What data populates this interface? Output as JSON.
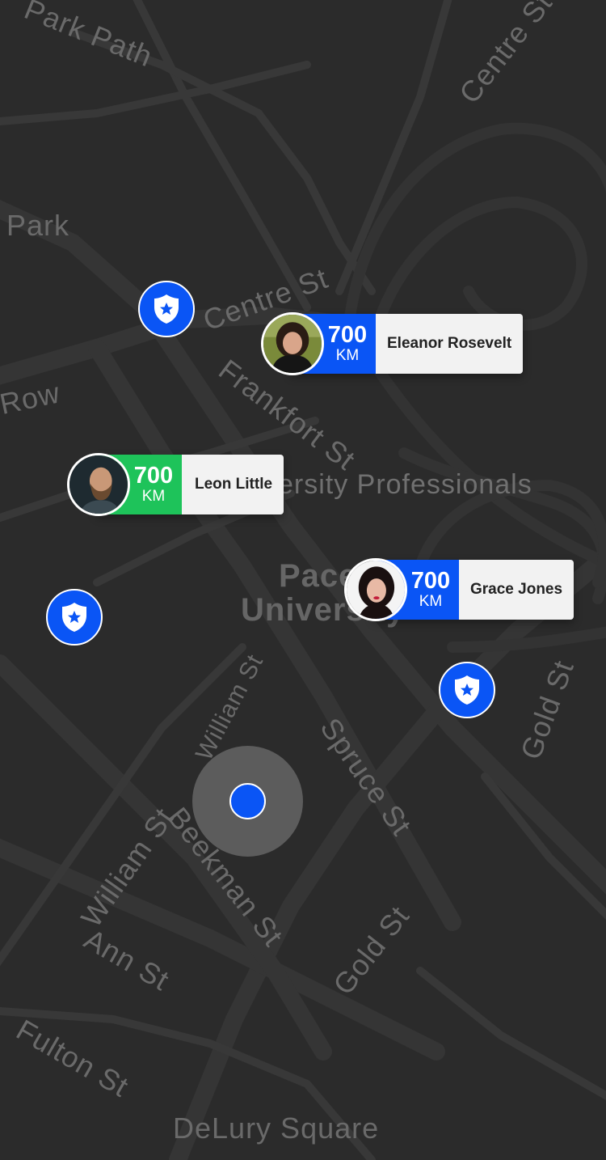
{
  "map": {
    "street_labels": [
      "Park Path",
      "Centre St",
      "Park",
      "Centre St",
      "Row",
      "Frankfort St",
      "Pace University Professionals",
      "Pace",
      "University",
      "William St",
      "Spruce St",
      "Gold St",
      "William St",
      "Beekman St",
      "Ann St",
      "Gold St",
      "Fulton St",
      "DeLury Square"
    ]
  },
  "police_markers": [
    {
      "icon": "police-badge-icon"
    },
    {
      "icon": "police-badge-icon"
    },
    {
      "icon": "police-badge-icon"
    }
  ],
  "contacts": [
    {
      "name": "Eleanor Rosevelt",
      "distance": "700",
      "unit": "KM",
      "color": "#0a55f5"
    },
    {
      "name": "Leon Little",
      "distance": "700",
      "unit": "KM",
      "color": "#1ec35a"
    },
    {
      "name": "Grace Jones",
      "distance": "700",
      "unit": "KM",
      "color": "#0a55f5"
    }
  ],
  "colors": {
    "accent": "#0a55f5",
    "green": "#1ec35a",
    "map_bg": "#2b2b2b"
  }
}
